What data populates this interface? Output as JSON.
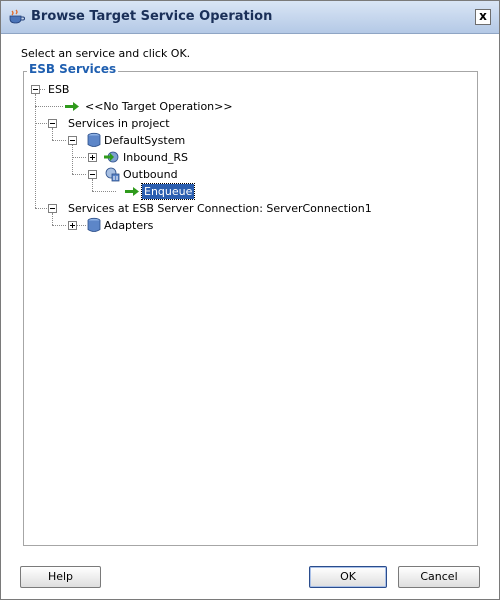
{
  "window": {
    "title": "Browse Target Service Operation",
    "close_label": "x"
  },
  "instruction": "Select an service and click OK.",
  "group": {
    "legend": "ESB Services"
  },
  "tree": {
    "root": "ESB",
    "no_target": "<<No Target Operation>>",
    "services_in_project": "Services in project",
    "default_system": "DefaultSystem",
    "inbound_rs": "Inbound_RS",
    "outbound": "Outbound",
    "enqueue": "Enqueue",
    "services_at_server": "Services at ESB Server Connection: ServerConnection1",
    "adapters": "Adapters"
  },
  "buttons": {
    "help": "Help",
    "ok": "OK",
    "cancel": "Cancel"
  }
}
